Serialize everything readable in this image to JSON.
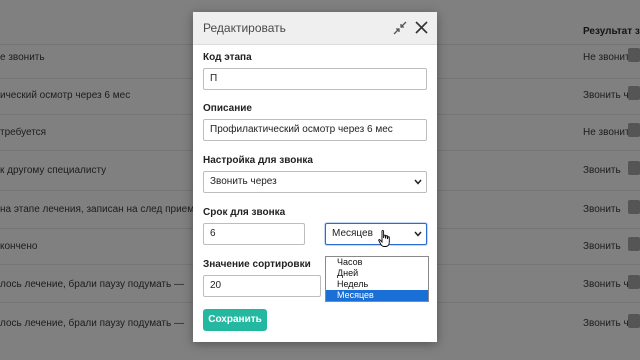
{
  "background": {
    "result_column_header": "Результат зв",
    "rows": [
      {
        "text": "е звонить",
        "result": "Не звонить"
      },
      {
        "text": "ический осмотр через 6 мес",
        "result": "Звонить черет"
      },
      {
        "text": "требуется",
        "result": "Не звонить"
      },
      {
        "text": "к другому специалисту",
        "result": "Звонить"
      },
      {
        "text": "на этапе лечения, записан на след прием.",
        "result": "Звонить"
      },
      {
        "text": "кончено",
        "result": "Звонить"
      },
      {
        "text": "лось лечение, брали паузу подумать —",
        "result": "Звонить черет"
      },
      {
        "text": "лось лечение, брали паузу подумать —",
        "result": "Звонить черет"
      }
    ]
  },
  "modal": {
    "title": "Редактировать",
    "fields": {
      "stage_code_label": "Код этапа",
      "stage_code_value": "П",
      "description_label": "Описание",
      "description_value": "Профилактический осмотр через 6 мес",
      "call_setting_label": "Настройка для звонка",
      "call_setting_value": "Звонить через",
      "call_term_label": "Срок для звонка",
      "call_term_value": "6",
      "call_unit_value": "Месяцев",
      "sort_label": "Значение сортировки",
      "sort_value": "20"
    },
    "unit_options": [
      "Часов",
      "Дней",
      "Недель",
      "Месяцев"
    ],
    "selected_unit_option": "Месяцев",
    "save_label": "Сохранить"
  },
  "colors": {
    "overlay": "#808080",
    "save_button": "#24b8a0",
    "dropdown_highlight": "#1a6fd6",
    "focus_border": "#2a6bd4"
  },
  "icons": [
    "collapse-icon",
    "close-icon",
    "chevron-down-icon",
    "hand-cursor-icon"
  ]
}
